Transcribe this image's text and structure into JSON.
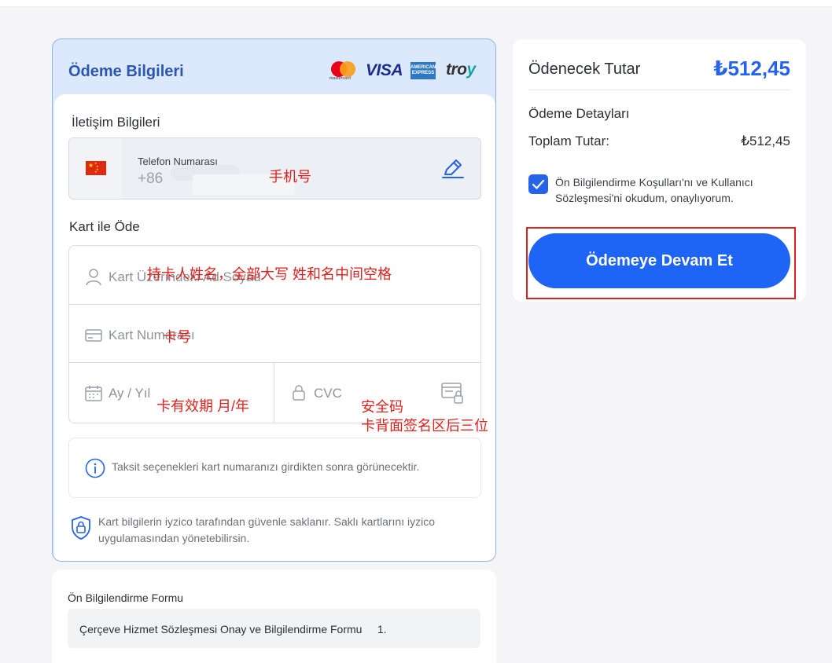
{
  "payment": {
    "title": "Ödeme Bilgileri",
    "brands": {
      "mastercard_text": "mastercard",
      "visa": "VISA",
      "amex": "AMERICAN EXPRESS",
      "troy_prefix": "tro",
      "troy_suffix": "y"
    },
    "contact": {
      "title": "İletişim Bilgileri",
      "flag_icon": "china-flag-icon",
      "phone_label": "Telefon Numarası",
      "phone_prefix": "+86"
    },
    "card": {
      "title": "Kart ile Öde",
      "name_placeholder": "Kart Üzerindeki Ad Soyad",
      "number_placeholder": "Kart Numarası",
      "expiry_placeholder": "Ay / Yıl",
      "cvc_placeholder": "CVC"
    },
    "installment_info": "Taksit seçenekleri kart numaranızı girdikten sonra görünecektir.",
    "secure_note": "Kart bilgilerin iyzico tarafından güvenle saklanır. Saklı kartlarını iyzico uygulamasından yönetebilirsin."
  },
  "annotations": {
    "phone": "手机号",
    "name": "持卡人姓名，全部大写 姓和名中间空格",
    "number": "卡号",
    "expiry": "卡有效期 月/年",
    "cvc_line1": "安全码",
    "cvc_line2": "卡背面签名区后三位"
  },
  "preinfo": {
    "title": "Ön Bilgilendirme Formu",
    "item": "Çerçeve Hizmet Sözleşmesi Onay ve Bilgilendirme Formu     1."
  },
  "summary": {
    "amount_label": "Ödenecek Tutar",
    "amount_value": "₺512,45",
    "details_title": "Ödeme Detayları",
    "total_label": "Toplam Tutar:",
    "total_value": "₺512,45",
    "terms_checked": true,
    "terms_text": "Ön Bilgilendirme Koşulları'nı ve Kullanıcı Sözleşmesi'ni okudum, onaylıyorum.",
    "button_label": "Ödemeye Devam Et"
  },
  "colors": {
    "accent": "#1f65f5",
    "header_bg": "#dce8fc",
    "annotation": "#e0201c"
  }
}
